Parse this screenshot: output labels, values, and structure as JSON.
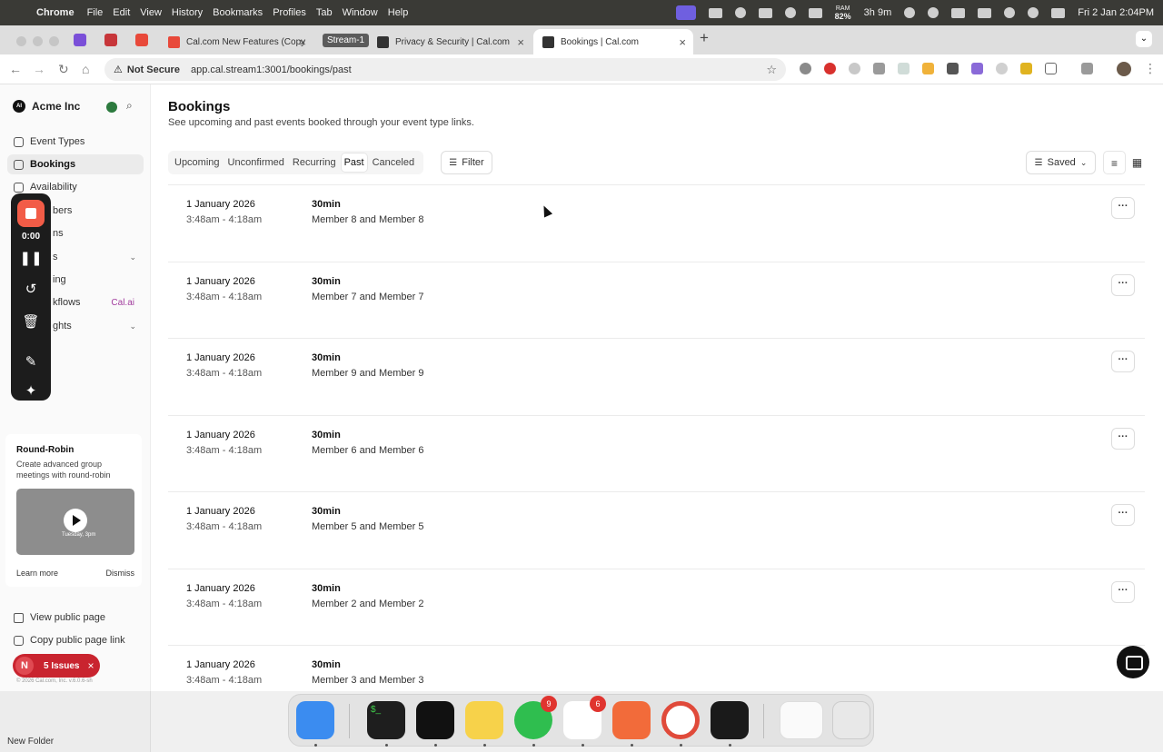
{
  "menubar": {
    "app": "Chrome",
    "items": [
      "File",
      "Edit",
      "View",
      "History",
      "Bookmarks",
      "Profiles",
      "Tab",
      "Window",
      "Help"
    ],
    "ram_label": "RAM",
    "ram_value": "82%",
    "battery_time": "3h 9m",
    "datetime": "Fri 2 Jan  2:04PM"
  },
  "tabs": [
    {
      "title": "Cal.com New Features (Copy",
      "color": "#e8493a"
    },
    {
      "title": "Stream-1"
    },
    {
      "title": "Privacy & Security | Cal.com",
      "color": "#333333"
    },
    {
      "title": "Bookings | Cal.com",
      "color": "#333333",
      "active": true
    }
  ],
  "address": {
    "security": "Not Secure",
    "url": "app.cal.stream1:3001/bookings/past"
  },
  "sidebar": {
    "org_name": "Acme Inc",
    "org_logo": "AI",
    "items": [
      {
        "label": "Event Types",
        "icon": "link-icon"
      },
      {
        "label": "Bookings",
        "icon": "calendar-icon",
        "active": true
      },
      {
        "label": "Availability",
        "icon": "clock-icon"
      },
      {
        "label": "bers",
        "icon": "users-icon"
      },
      {
        "label": "ns",
        "icon": "grid-icon"
      },
      {
        "label": "s",
        "icon": "apps-icon",
        "expandable": true
      },
      {
        "label": "ing",
        "icon": "routing-icon"
      },
      {
        "label": "kflows",
        "icon": "workflow-icon",
        "tag": "Cal.ai"
      },
      {
        "label": "ghts",
        "icon": "chart-icon",
        "expandable": true
      }
    ],
    "promo": {
      "title": "Round-Robin",
      "description": "Create advanced group meetings with round-robin",
      "thumb_caption": "Tuesday, 3pm",
      "learn_more": "Learn more",
      "dismiss": "Dismiss"
    },
    "footer": [
      {
        "label": "View public page",
        "icon": "external-link-icon"
      },
      {
        "label": "Copy public page link",
        "icon": "copy-icon"
      }
    ],
    "issues": {
      "initial": "N",
      "label": "5 Issues"
    },
    "copyright": "© 2026 Cal.com, Inc. v.6.0.6-sh"
  },
  "recorder": {
    "time": "0:00"
  },
  "main": {
    "title": "Bookings",
    "subtitle": "See upcoming and past events booked through your event type links.",
    "tabs": [
      "Upcoming",
      "Unconfirmed",
      "Recurring",
      "Past",
      "Canceled"
    ],
    "active_tab": "Past",
    "filter_label": "Filter",
    "saved_label": "Saved"
  },
  "bookings": [
    {
      "date": "1 January 2026",
      "time": "3:48am - 4:18am",
      "event": "30min",
      "attendees": "Member 8 and Member 8"
    },
    {
      "date": "1 January 2026",
      "time": "3:48am - 4:18am",
      "event": "30min",
      "attendees": "Member 7 and Member 7"
    },
    {
      "date": "1 January 2026",
      "time": "3:48am - 4:18am",
      "event": "30min",
      "attendees": "Member 9 and Member 9"
    },
    {
      "date": "1 January 2026",
      "time": "3:48am - 4:18am",
      "event": "30min",
      "attendees": "Member 6 and Member 6"
    },
    {
      "date": "1 January 2026",
      "time": "3:48am - 4:18am",
      "event": "30min",
      "attendees": "Member 5 and Member 5"
    },
    {
      "date": "1 January 2026",
      "time": "3:48am - 4:18am",
      "event": "30min",
      "attendees": "Member 2 and Member 2"
    },
    {
      "date": "1 January 2026",
      "time": "3:48am - 4:18am",
      "event": "30min",
      "attendees": "Member 3 and Member 3"
    }
  ],
  "dock": {
    "apps": [
      {
        "name": "finder-icon",
        "color": "#3b8cf0"
      },
      {
        "name": "terminal-icon",
        "color": "#1e1e1e",
        "glyph": "$_"
      },
      {
        "name": "cursor-app-icon",
        "color": "#111111"
      },
      {
        "name": "notes-icon",
        "color": "#f7d24a"
      },
      {
        "name": "whatsapp-icon",
        "color": "#2fbe4f",
        "badge": "9"
      },
      {
        "name": "slack-icon",
        "color": "#ffffff",
        "badge": "6"
      },
      {
        "name": "postman-icon",
        "color": "#f26b3a"
      },
      {
        "name": "chrome-icon",
        "color": "#ffffff"
      },
      {
        "name": "app-icon",
        "color": "#1a1a1a"
      }
    ]
  },
  "finder": {
    "new_folder": "New Folder"
  }
}
